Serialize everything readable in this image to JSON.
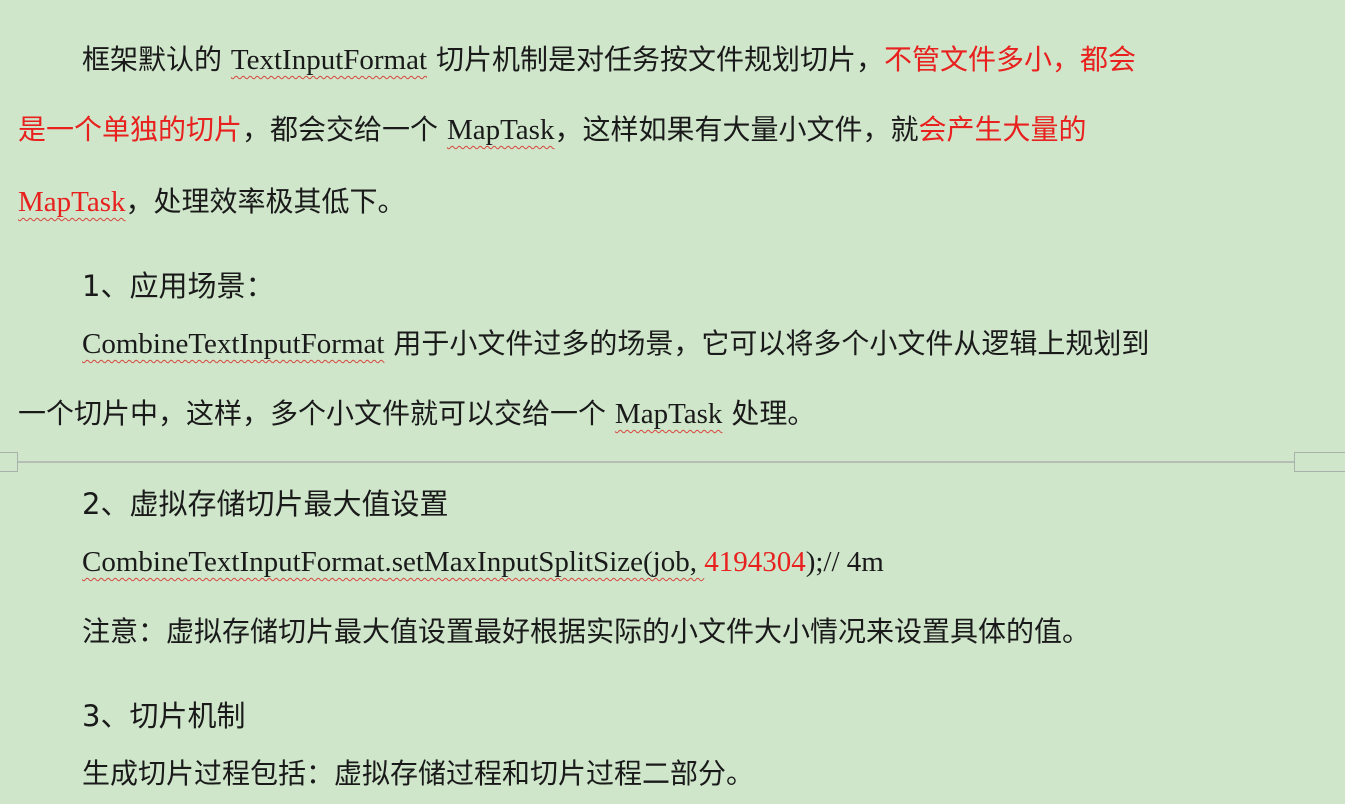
{
  "para1": {
    "l1_a": "框架默认的",
    "l1_term": "TextInputFormat",
    "l1_b": "切片机制是对任务按文件规划切片，",
    "l1_red": "不管文件多小，都会",
    "l2_red": "是一个单独的切片",
    "l2_a": "，都会交给一个",
    "l2_term": "MapTask",
    "l2_b": "，这样如果有大量小文件，就",
    "l2_red2": "会产生大量的",
    "l3_red_term": "MapTask",
    "l3_a": "，处理效率极其低下。"
  },
  "section1": {
    "heading": "1、应用场景：",
    "l1_term": "CombineTextInputFormat",
    "l1_a": "用于小文件过多的场景，它可以将多个小文件从逻辑上规划到",
    "l2_a": "一个切片中，这样，多个小文件就可以交给一个",
    "l2_term": "MapTask",
    "l2_b": "处理。"
  },
  "section2": {
    "heading": "2、虚拟存储切片最大值设置",
    "code_class": "CombineTextInputFormat",
    "code_method": ".setMaxInputSplitSize(job, ",
    "code_value": "4194304",
    "code_tail": ");// 4m",
    "note": "注意：虚拟存储切片最大值设置最好根据实际的小文件大小情况来设置具体的值。"
  },
  "section3": {
    "heading": "3、切片机制",
    "body": "生成切片过程包括：虚拟存储过程和切片过程二部分。"
  },
  "colors": {
    "background": "#cfe6cb",
    "emphasis": "#e8201e",
    "text": "#1a1a1a"
  }
}
